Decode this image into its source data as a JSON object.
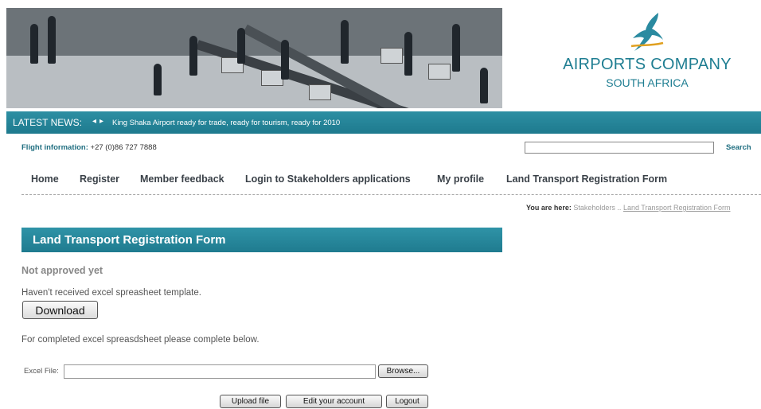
{
  "logo": {
    "line1": "AIRPORTS COMPANY",
    "line2": "SOUTH AFRICA",
    "icon": "bird-figure-icon",
    "color": "#1f7e92"
  },
  "news": {
    "label": "LATEST NEWS:",
    "prev": "◂",
    "next": "▸",
    "text": "King Shaka Airport ready for trade, ready for tourism, ready for 2010"
  },
  "flight": {
    "label": "Flight information:",
    "number": "+27 (0)86 727 7888"
  },
  "search": {
    "value": "",
    "label": "Search"
  },
  "menu": {
    "items": [
      "Home",
      "Register",
      "Member feedback",
      "Login to Stakeholders applications",
      "My profile",
      "Land Transport Registration Form"
    ]
  },
  "breadcrumb": {
    "prefix": "You are here:",
    "item1": "Stakeholders ..",
    "item2": "Land Transport Registration Form"
  },
  "form": {
    "title": "Land Transport Registration Form",
    "status": "Not approved yet",
    "template_text": "Haven't received excel spreasheet template.",
    "download_label": "Download",
    "completed_text": "For completed excel spreasdsheet please complete below.",
    "file_label": "Excel File:",
    "file_value": "",
    "browse_label": "Browse...",
    "upload_label": "Upload file",
    "edit_label": "Edit your account",
    "logout_label": "Logout"
  },
  "colors": {
    "accent": "#1f7b8f",
    "link": "#1f6e80"
  }
}
